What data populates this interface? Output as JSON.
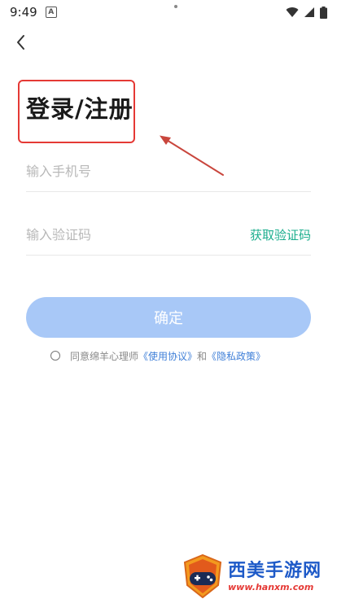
{
  "status_bar": {
    "time": "9:49",
    "notification_badge": "A"
  },
  "header": {
    "back_icon": "chevron-left-icon"
  },
  "title": "登录/注册",
  "form": {
    "phone_placeholder": "输入手机号",
    "phone_value": "",
    "code_placeholder": "输入验证码",
    "code_value": "",
    "get_code_label": "获取验证码",
    "confirm_label": "确定"
  },
  "agreement": {
    "prefix": "同意绵羊心理师",
    "terms_link": "《使用协议》",
    "joiner": "和",
    "privacy_link": "《隐私政策》",
    "checked": false
  },
  "watermark": {
    "title": "西美手游网",
    "url": "www.hanxm.com"
  },
  "colors": {
    "annotation_red": "#e53935",
    "accent_green": "#1cae8e",
    "button_blue_disabled": "#a8c8f7",
    "link_blue": "#3f7fd8"
  }
}
